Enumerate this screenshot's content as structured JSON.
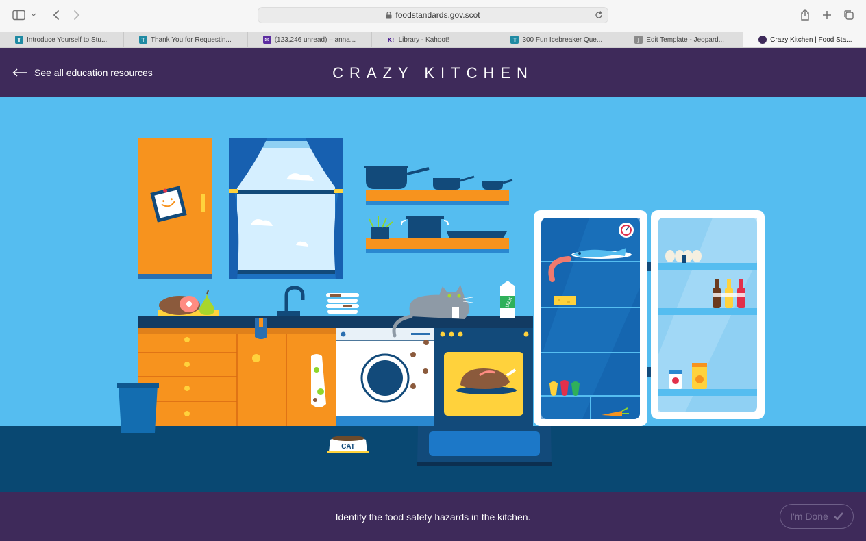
{
  "browser": {
    "url": "foodstandards.gov.scot",
    "tabs": [
      {
        "title": "Introduce Yourself to Stu...",
        "fav": "T",
        "color": "#1f8aa3"
      },
      {
        "title": "Thank You for Requestin...",
        "fav": "T",
        "color": "#1f8aa3"
      },
      {
        "title": "(123,246 unread) – anna...",
        "fav": "✉",
        "color": "#5b2ca0"
      },
      {
        "title": "Library - Kahoot!",
        "fav": "K!",
        "color": "#46178f"
      },
      {
        "title": "300 Fun Icebreaker Que...",
        "fav": "T",
        "color": "#1f8aa3"
      },
      {
        "title": "Edit Template - Jeopard...",
        "fav": "J",
        "color": "#8a8a8a"
      },
      {
        "title": "Crazy Kitchen | Food Sta...",
        "fav": "",
        "color": "#3e2a5a",
        "active": true
      }
    ]
  },
  "header": {
    "back_label": "See all education resources",
    "title": "CRAZY KITCHEN"
  },
  "scene": {
    "milk_label": "MILK",
    "cat_bowl_label": "CAT"
  },
  "footer": {
    "instruction": "Identify the food safety hazards in the kitchen.",
    "done_label": "I'm Done"
  },
  "colors": {
    "brand_purple": "#3e2a5a",
    "wall_blue": "#55bdf0",
    "floor_navy": "#094872",
    "cabinet_orange": "#f7931e"
  }
}
